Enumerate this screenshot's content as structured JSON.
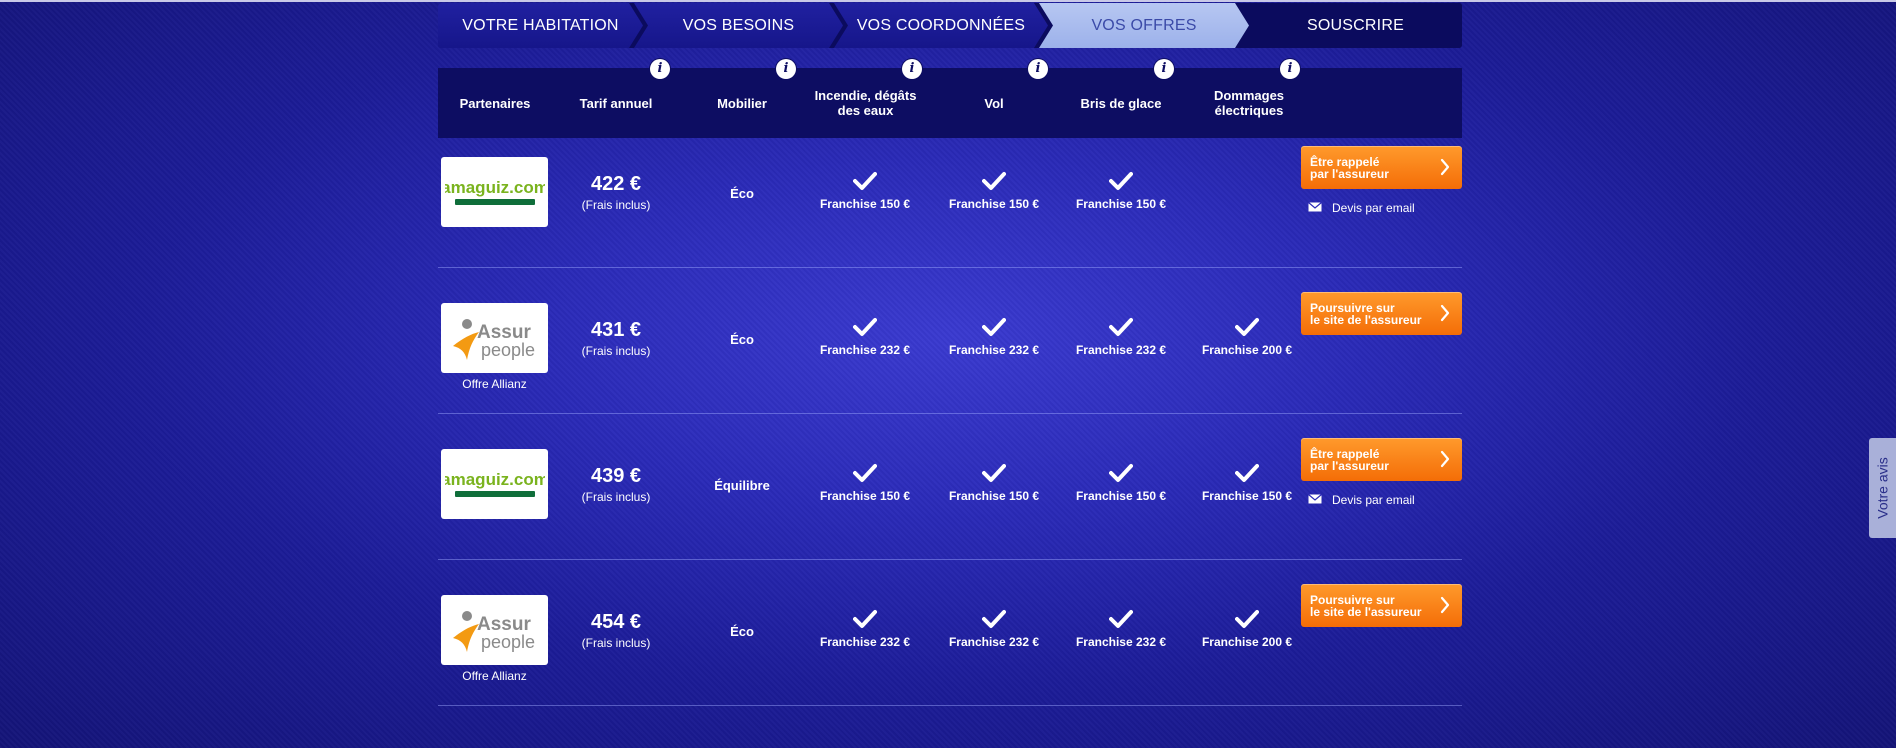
{
  "steps": [
    {
      "label": "VOTRE HABITATION",
      "state": "done"
    },
    {
      "label": "VOS BESOINS",
      "state": "done"
    },
    {
      "label": "VOS COORDONNÉES",
      "state": "done"
    },
    {
      "label": "VOS OFFRES",
      "state": "active"
    },
    {
      "label": "SOUSCRIRE",
      "state": "todo"
    }
  ],
  "columns": {
    "partenaires": "Partenaires",
    "tarif": "Tarif annuel",
    "mobilier": "Mobilier",
    "incendie": "Incendie, dégâts des eaux",
    "vol": "Vol",
    "bris": "Bris de glace",
    "dommages": "Dommages électriques",
    "info_glyph": "i"
  },
  "offers": [
    {
      "partner": "amaguiz.com",
      "partner_sub": "",
      "price": "422 €",
      "price_note": "(Frais inclus)",
      "mobilier": "Éco",
      "incendie": "Franchise 150 €",
      "vol": "Franchise 150 €",
      "bris": "Franchise 150 €",
      "dommages": "",
      "cta": "Être rappelé\npar l'assureur",
      "email": "Devis par email"
    },
    {
      "partner": "Assur people",
      "partner_sub": "Offre Allianz",
      "price": "431 €",
      "price_note": "(Frais inclus)",
      "mobilier": "Éco",
      "incendie": "Franchise 232 €",
      "vol": "Franchise 232 €",
      "bris": "Franchise 232 €",
      "dommages": "Franchise 200 €",
      "cta": "Poursuivre sur\nle site de l'assureur",
      "email": ""
    },
    {
      "partner": "amaguiz.com",
      "partner_sub": "",
      "price": "439 €",
      "price_note": "(Frais inclus)",
      "mobilier": "Équilibre",
      "incendie": "Franchise 150 €",
      "vol": "Franchise 150 €",
      "bris": "Franchise 150 €",
      "dommages": "Franchise 150 €",
      "cta": "Être rappelé\npar l'assureur",
      "email": "Devis par email"
    },
    {
      "partner": "Assur people",
      "partner_sub": "Offre Allianz",
      "price": "454 €",
      "price_note": "(Frais inclus)",
      "mobilier": "Éco",
      "incendie": "Franchise 232 €",
      "vol": "Franchise 232 €",
      "bris": "Franchise 232 €",
      "dommages": "Franchise 200 €",
      "cta": "Poursuivre sur\nle site de l'assureur",
      "email": ""
    }
  ],
  "feedback_tab": "Votre avis",
  "colors": {
    "cta": "#f47a12",
    "header": "#0d0d62",
    "active_step": "#a9bbee"
  }
}
